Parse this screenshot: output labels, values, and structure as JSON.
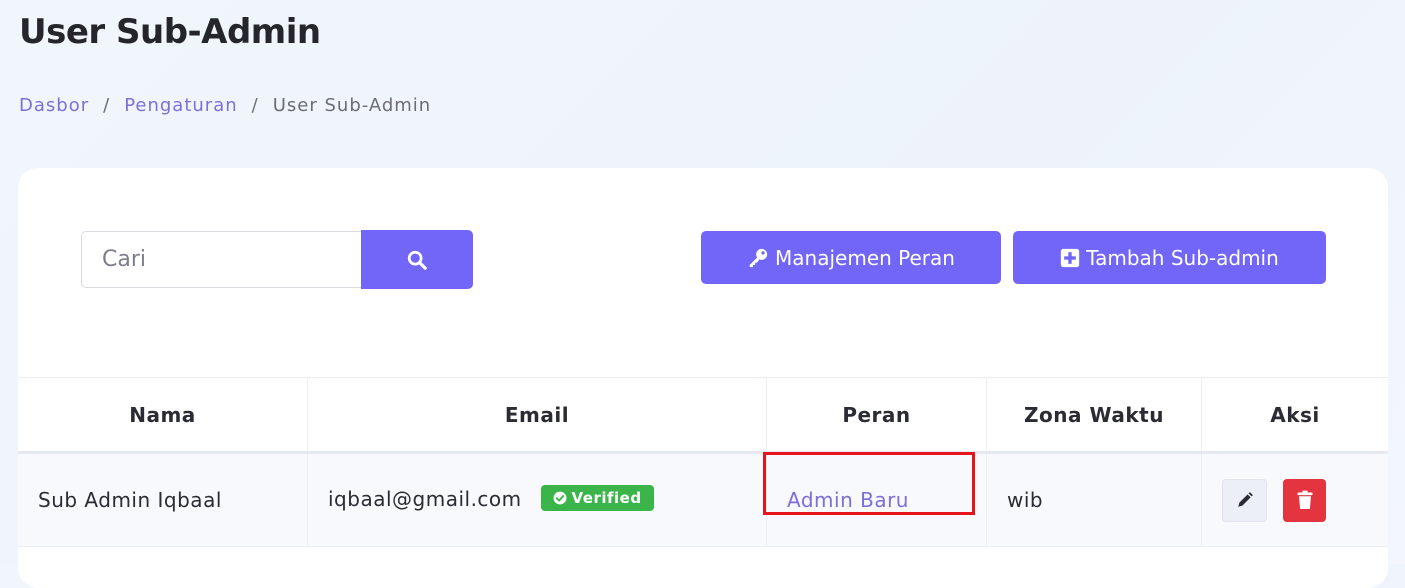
{
  "page": {
    "title": "User Sub-Admin"
  },
  "breadcrumb": {
    "items": [
      {
        "label": "Dasbor"
      },
      {
        "label": "Pengaturan"
      },
      {
        "label": "User Sub-Admin"
      }
    ],
    "separator": "/"
  },
  "toolbar": {
    "search_placeholder": "Cari",
    "search_value": "",
    "roles_button_label": "Manajemen Peran",
    "add_button_label": "Tambah Sub-admin"
  },
  "table": {
    "columns": [
      "Nama",
      "Email",
      "Peran",
      "Zona Waktu",
      "Aksi"
    ],
    "rows": [
      {
        "name": "Sub Admin Iqbaal",
        "email": "iqbaal@gmail.com",
        "email_status": "Verified",
        "role": "Admin Baru",
        "timezone": "wib"
      }
    ]
  },
  "colors": {
    "accent": "#7266f8",
    "link": "#7b70d9",
    "verified": "#3bb54a",
    "danger": "#e3343f",
    "highlight": "#e8141c"
  },
  "icons": {
    "search": "search-icon",
    "key": "key-icon",
    "plus": "plus-square-icon",
    "check": "check-circle-icon",
    "edit": "pencil-icon",
    "delete": "trash-icon"
  }
}
